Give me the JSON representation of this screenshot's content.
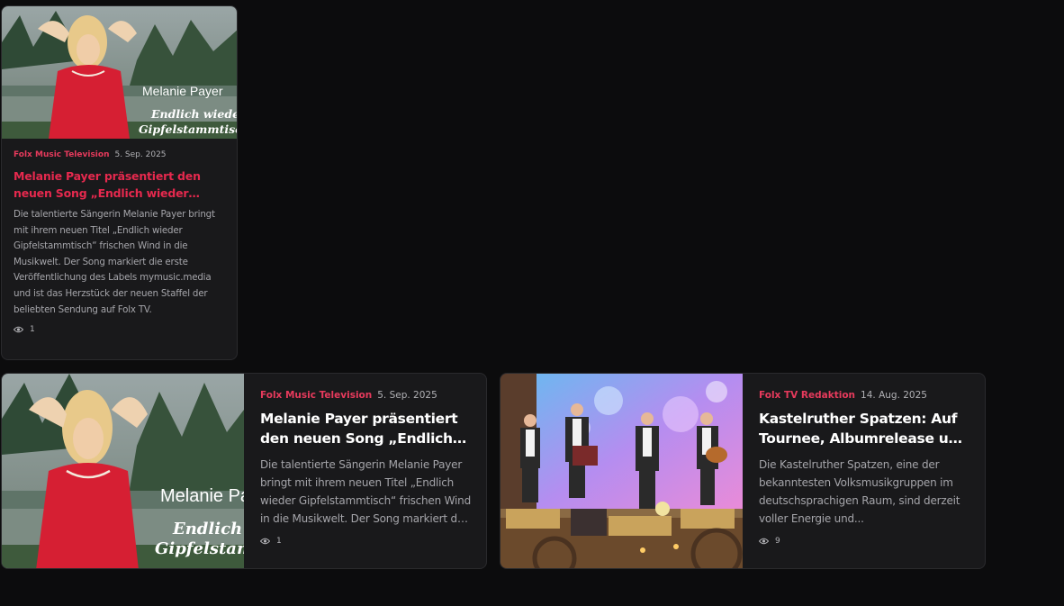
{
  "cards": [
    {
      "source": "Folx Music Television",
      "date": "5. Sep. 2025",
      "title": "Melanie Payer präsentiert den neuen Song „Endlich wieder Gipfelstammtisch“",
      "excerpt": "Die talentierte Sängerin Melanie Payer bringt mit ihrem neuen Titel „Endlich wieder Gipfelstammtisch“ frischen Wind in die Musikwelt. Der Song markiert die erste Veröffentlichung des Labels mymusic.media und ist das Herzstück der neuen Staffel der beliebten Sendung auf Folx TV.",
      "views": "1",
      "thumb_text_name": "Melanie Payer",
      "thumb_text_line1": "Endlich wieder",
      "thumb_text_line2": "Gipfelstammtisch"
    },
    {
      "source": "Folx Music Television",
      "date": "5. Sep. 2025",
      "title": "Melanie Payer präsentiert den neuen Song „Endlich wieder Gipfelstammtisch“",
      "excerpt": "Die talentierte Sängerin Melanie Payer bringt mit ihrem neuen Titel „Endlich wieder Gipfelstammtisch“ frischen Wind in die Musikwelt. Der Song markiert die erste Veröffentlichung des Labels mymusic.media.",
      "views": "1",
      "thumb_text_name": "Melanie Pa",
      "thumb_text_line1": "Endlich w",
      "thumb_text_line2": "Gipfelstamm"
    },
    {
      "source": "Folx TV Redaktion",
      "date": "14. Aug. 2025",
      "title": "Kastelruther Spatzen: Auf Tournee, Albumrelease und mehr",
      "excerpt": "Die Kastelruther Spatzen, eine der bekanntesten Volksmusikgruppen im deutschsprachigen Raum, sind derzeit voller Energie und...",
      "views": "9"
    }
  ],
  "colors": {
    "background": "#0c0c0d",
    "card": "#19191b",
    "accent": "#e6294e",
    "source": "#e63a5c"
  },
  "icons": {
    "views": "eye-icon"
  }
}
